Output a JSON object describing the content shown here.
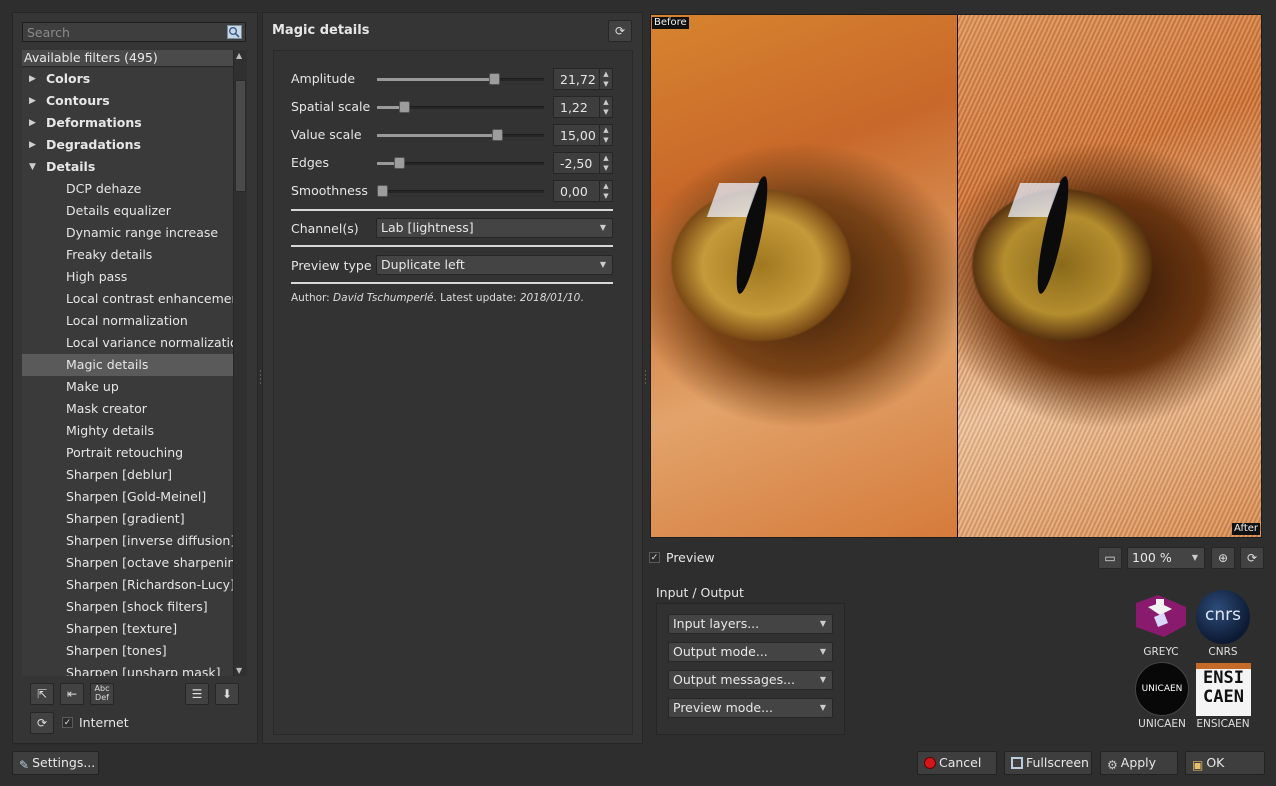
{
  "search": {
    "placeholder": "Search"
  },
  "filters": {
    "header": "Available filters (495)",
    "items": [
      {
        "label": "Colors",
        "type": "cat",
        "open": false
      },
      {
        "label": "Contours",
        "type": "cat",
        "open": false
      },
      {
        "label": "Deformations",
        "type": "cat",
        "open": false
      },
      {
        "label": "Degradations",
        "type": "cat",
        "open": false
      },
      {
        "label": "Details",
        "type": "cat",
        "open": true
      },
      {
        "label": "DCP dehaze",
        "type": "leaf"
      },
      {
        "label": "Details equalizer",
        "type": "leaf"
      },
      {
        "label": "Dynamic range increase",
        "type": "leaf"
      },
      {
        "label": "Freaky details",
        "type": "leaf"
      },
      {
        "label": "High pass",
        "type": "leaf"
      },
      {
        "label": "Local contrast enhancemen",
        "type": "leaf"
      },
      {
        "label": "Local normalization",
        "type": "leaf"
      },
      {
        "label": "Local variance normalizatio",
        "type": "leaf"
      },
      {
        "label": "Magic details",
        "type": "leaf",
        "selected": true
      },
      {
        "label": "Make up",
        "type": "leaf"
      },
      {
        "label": "Mask creator",
        "type": "leaf"
      },
      {
        "label": "Mighty details",
        "type": "leaf"
      },
      {
        "label": "Portrait retouching",
        "type": "leaf"
      },
      {
        "label": "Sharpen [deblur]",
        "type": "leaf"
      },
      {
        "label": "Sharpen [Gold-Meinel]",
        "type": "leaf"
      },
      {
        "label": "Sharpen [gradient]",
        "type": "leaf"
      },
      {
        "label": "Sharpen [inverse diffusion]",
        "type": "leaf"
      },
      {
        "label": "Sharpen [octave sharpening",
        "type": "leaf"
      },
      {
        "label": "Sharpen [Richardson-Lucy]",
        "type": "leaf"
      },
      {
        "label": "Sharpen [shock filters]",
        "type": "leaf"
      },
      {
        "label": "Sharpen [texture]",
        "type": "leaf"
      },
      {
        "label": "Sharpen [tones]",
        "type": "leaf"
      },
      {
        "label": "Sharpen [unsharp mask]",
        "type": "leaf"
      }
    ],
    "internet_label": "Internet"
  },
  "filter_panel": {
    "title": "Magic details",
    "params": [
      {
        "label": "Amplitude",
        "value": "21,72",
        "fraction": 0.72
      },
      {
        "label": "Spatial scale",
        "value": "1,22",
        "fraction": 0.14
      },
      {
        "label": "Value scale",
        "value": "15,00",
        "fraction": 0.74
      },
      {
        "label": "Edges",
        "value": "-2,50",
        "fraction": 0.11
      },
      {
        "label": "Smoothness",
        "value": "0,00",
        "fraction": 0.0
      }
    ],
    "channels_label": "Channel(s)",
    "channels_value": "Lab [lightness]",
    "preview_type_label": "Preview type",
    "preview_type_value": "Duplicate left",
    "author_prefix": "Author: ",
    "author_name": "David Tschumperlé",
    "update_prefix": ". Latest update: ",
    "update_date": "2018/01/10",
    "update_suffix": "."
  },
  "preview": {
    "before_label": "Before",
    "after_label": "After",
    "checkbox_label": "Preview",
    "zoom": "100 %"
  },
  "io": {
    "title": "Input / Output",
    "input_layers": "Input layers...",
    "output_mode": "Output mode...",
    "output_messages": "Output messages...",
    "preview_mode": "Preview mode..."
  },
  "logos": {
    "greyc": "GREYC",
    "cnrs": "CNRS",
    "cnrs_mark": "cnrs",
    "unicaen": "UNICAEN",
    "unicaen_mark": "UNICAEN",
    "ensicaen": "ENSICAEN",
    "ensi_top": "ENSI",
    "ensi_bottom": "CAEN"
  },
  "buttons": {
    "settings": "Settings...",
    "cancel": "Cancel",
    "fullscreen": "Fullscreen",
    "apply": "Apply",
    "ok": "OK"
  },
  "colors": {
    "background": "#2e2e2e",
    "panel": "#353535",
    "selection": "#5a5a5a"
  }
}
